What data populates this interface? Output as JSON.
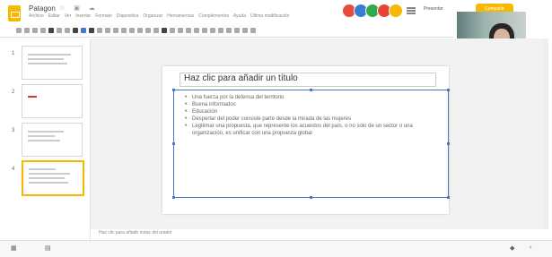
{
  "app": {
    "doc_title": "Patagon",
    "title_icons": "☆ ▣ ☁",
    "menu": [
      "Archivo",
      "Editar",
      "Ver",
      "Insertar",
      "Formato",
      "Diapositiva",
      "Organizar",
      "Herramientas",
      "Complementos",
      "Ayuda",
      "Última modificación"
    ],
    "present_label": "Presentar",
    "share_label": "Compartir",
    "avatar_colors": [
      "#e84c3d",
      "#3a7bd5",
      "#2eaa4f",
      "#ea4335",
      "#f6b900"
    ],
    "accent": "#f6b900",
    "selection_color": "#4a78c8"
  },
  "webcam": {
    "label": "participante"
  },
  "slides": [
    {
      "num": "1",
      "selected": false
    },
    {
      "num": "2",
      "selected": false
    },
    {
      "num": "3",
      "selected": false
    },
    {
      "num": "4",
      "selected": true
    }
  ],
  "slide": {
    "title": "Haz clic para añadir un título",
    "bullets": [
      "Una fuerza por la defensa del territorio",
      "Buena informados",
      "Educación",
      "Despertar del poder consiste parte desde la mirada de las mujeres",
      "Legitimar una propuesta, que represente los acuerdos del país, o no solo de un sector o una organización, es unificar con una propuesta global"
    ]
  },
  "notes": {
    "placeholder": "Haz clic para añadir notas del orador"
  }
}
